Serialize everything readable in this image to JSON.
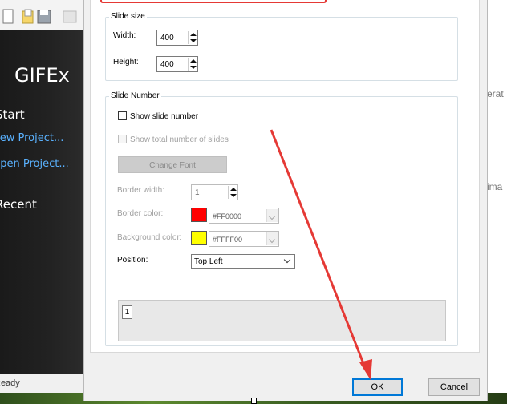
{
  "background_app": {
    "title": "GIFEx",
    "start_heading": "Start",
    "new_project": "New Project...",
    "open_project": "Open Project...",
    "recent_heading": "Recent",
    "status": "Ready",
    "right_text_1": "erat",
    "right_text_2": "ima"
  },
  "dialog": {
    "slide_size": {
      "legend": "Slide size",
      "width_label": "Width:",
      "width_value": "400",
      "height_label": "Height:",
      "height_value": "400"
    },
    "slide_number": {
      "legend": "Slide Number",
      "show_number_label": "Show slide number",
      "show_number_checked": false,
      "show_total_label": "Show total number of slides",
      "show_total_checked": false,
      "change_font_label": "Change Font",
      "border_width_label": "Border width:",
      "border_width_value": "1",
      "border_color_label": "Border color:",
      "border_color_hex": "#FF0000",
      "border_color_swatch": "#ff0000",
      "background_color_label": "Background color:",
      "background_color_hex": "#FFFF00",
      "background_color_swatch": "#ffff00",
      "position_label": "Position:",
      "position_value": "Top Left",
      "preview_number": "1"
    },
    "ok_label": "OK",
    "cancel_label": "Cancel"
  },
  "colors": {
    "annotation_red": "#e53935",
    "link_blue": "#5ab2ff",
    "focus_blue": "#0078d7"
  }
}
